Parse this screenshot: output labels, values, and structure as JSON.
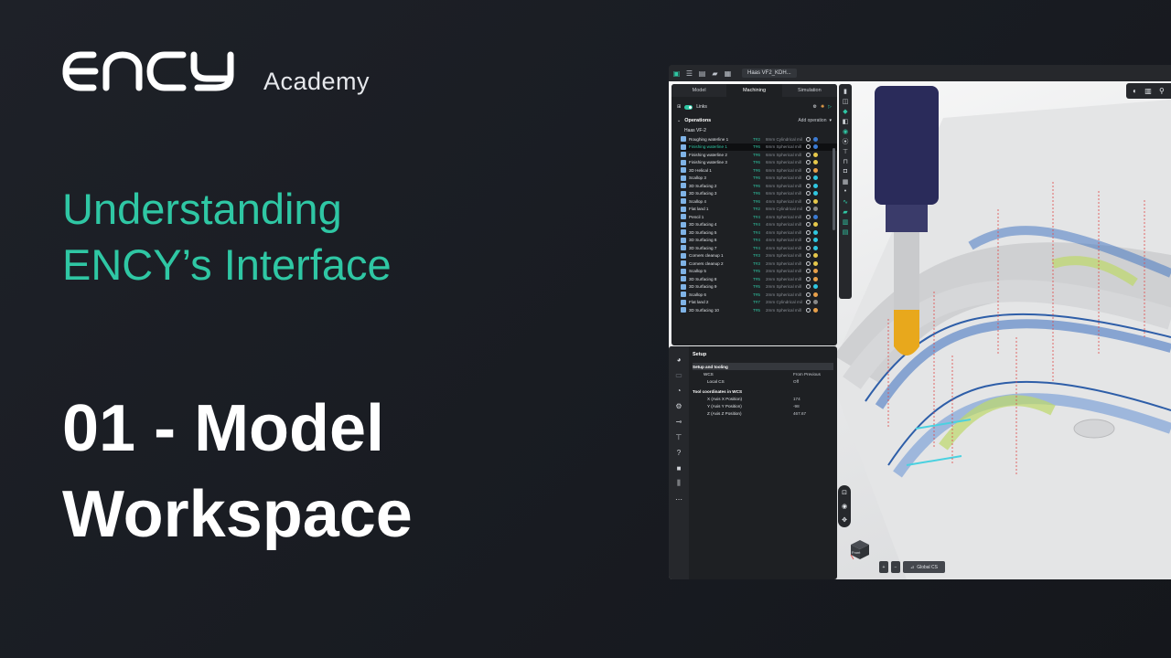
{
  "brand": {
    "name": "ENCY",
    "academy": "Academy"
  },
  "subtitle": [
    "Understanding",
    "ENCY’s Interface"
  ],
  "title": [
    "01 - Model",
    "Workspace"
  ],
  "colors": {
    "accent": "#2fc7a4",
    "bg": "#1a1d22"
  },
  "app": {
    "file_tab": "Haas VF2_KDH...",
    "tabs": [
      "Model",
      "Machining",
      "Simulation"
    ],
    "links": "Links",
    "operations": "Operations",
    "add_operation": "Add operation",
    "machine": "Haas VF-2",
    "ops": [
      {
        "name": "Roughing waterline 1",
        "tool": "T#2",
        "desc": "8mm Cylindrical mil",
        "color": "#3b7bd4"
      },
      {
        "name": "Finishing waterline 1",
        "tool": "T#6",
        "desc": "6mm Spherical mill",
        "color": "#3b7bd4"
      },
      {
        "name": "Finishing waterline 2",
        "tool": "T#6",
        "desc": "6mm Spherical mill",
        "color": "#e6c84a"
      },
      {
        "name": "Finishing waterline 3",
        "tool": "T#6",
        "desc": "6mm Spherical mill",
        "color": "#e6c84a"
      },
      {
        "name": "3D Helical 1",
        "tool": "T#6",
        "desc": "6mm Spherical mill",
        "color": "#e8a04a"
      },
      {
        "name": "Scallop 3",
        "tool": "T#6",
        "desc": "6mm Spherical mill",
        "color": "#2fc7e0"
      },
      {
        "name": "3D Surfacing 2",
        "tool": "T#6",
        "desc": "6mm Spherical mill",
        "color": "#2fc7e0"
      },
      {
        "name": "3D Surfacing 3",
        "tool": "T#6",
        "desc": "6mm Spherical mill",
        "color": "#2fc7e0"
      },
      {
        "name": "Scallop 4",
        "tool": "T#6",
        "desc": "4mm Spherical mill",
        "color": "#e6c84a"
      },
      {
        "name": "Flat land 1",
        "tool": "T#2",
        "desc": "8mm Cylindrical mil",
        "color": "#888"
      },
      {
        "name": "Pencil 1",
        "tool": "T#4",
        "desc": "4mm Spherical mill",
        "color": "#3b7bd4"
      },
      {
        "name": "3D Surfacing 4",
        "tool": "T#4",
        "desc": "4mm Spherical mill",
        "color": "#e6c84a"
      },
      {
        "name": "3D Surfacing 5",
        "tool": "T#4",
        "desc": "4mm Spherical mill",
        "color": "#2fc7e0"
      },
      {
        "name": "3D Surfacing 6",
        "tool": "T#4",
        "desc": "4mm Spherical mill",
        "color": "#2fc7e0"
      },
      {
        "name": "3D Surfacing 7",
        "tool": "T#4",
        "desc": "4mm Spherical mill",
        "color": "#2fc7e0"
      },
      {
        "name": "Corners cleanup 1",
        "tool": "T#3",
        "desc": "2mm Spherical mill",
        "color": "#e6c84a"
      },
      {
        "name": "Corners cleanup 2",
        "tool": "T#3",
        "desc": "2mm Spherical mill",
        "color": "#e6c84a"
      },
      {
        "name": "Scallop 5",
        "tool": "T#5",
        "desc": "2mm Spherical mill",
        "color": "#e8a04a"
      },
      {
        "name": "3D Surfacing 8",
        "tool": "T#5",
        "desc": "2mm Spherical mill",
        "color": "#e8a04a"
      },
      {
        "name": "3D Surfacing 9",
        "tool": "T#5",
        "desc": "2mm Spherical mill",
        "color": "#2fc7e0"
      },
      {
        "name": "Scallop 6",
        "tool": "T#5",
        "desc": "2mm Spherical mill",
        "color": "#e8a04a"
      },
      {
        "name": "Flat land 2",
        "tool": "T#7",
        "desc": "2mm Cylindrical mil",
        "color": "#888"
      },
      {
        "name": "3D Surfacing 10",
        "tool": "T#5",
        "desc": "2mm Spherical mill",
        "color": "#e8a04a"
      }
    ],
    "setup": {
      "title": "Setup",
      "group1": "Setup and tooling",
      "wcs_k": "WCS",
      "wcs_v": "From Previous",
      "lcs_k": "Local CS",
      "lcs_v": "Off",
      "group2": "Tool coordinates in WCS",
      "x_k": "X (Axis X Position)",
      "x_v": "174",
      "y_k": "Y (Axis Y Position)",
      "y_v": "-98",
      "z_k": "Z (Axis Z Position)",
      "z_v": "467.67"
    },
    "cube_label": "Front",
    "global_cs": "Global CS",
    "plus": "+",
    "minus": "−"
  }
}
